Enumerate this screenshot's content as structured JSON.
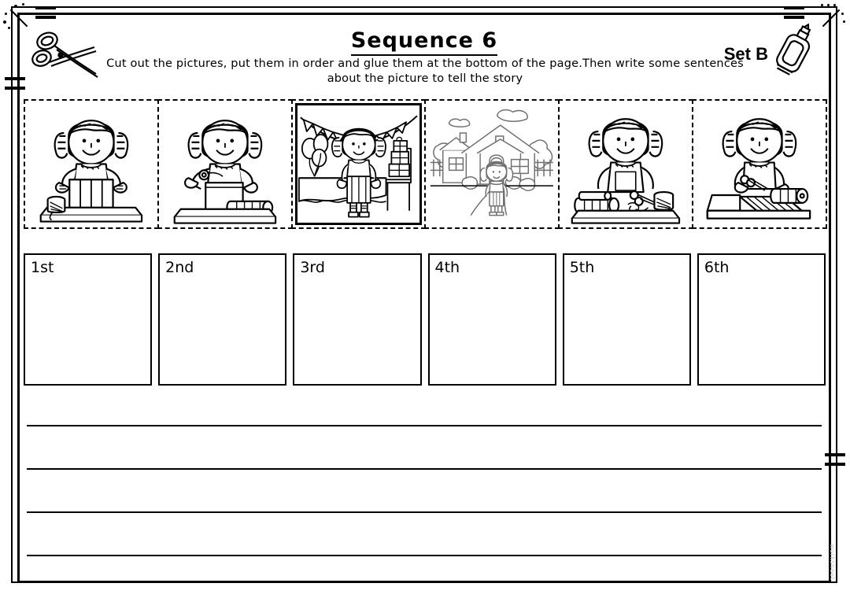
{
  "worksheet": {
    "title": "Sequence 6",
    "set_label": "Set B",
    "instructions": "Cut out the pictures, put them in order and glue them at the bottom of the page.Then write some sentences about the picture to tell the story",
    "watermark": "worksheet"
  },
  "decor": {
    "scissors_icon": "scissors-icon",
    "glue_icon": "glue-bottle-icon"
  },
  "cards": [
    {
      "id": "card-1",
      "name": "girl-holding-wrapped-gift",
      "description": "Girl with pigtails at a table holding a finished wrapped present with a ribbon spool beside her",
      "selected": false
    },
    {
      "id": "card-2",
      "name": "girl-placing-box-on-paper",
      "description": "Girl placing a plain box onto a sheet of wrapping paper with a paper roll on the table",
      "selected": false
    },
    {
      "id": "card-3",
      "name": "birthday-party-scene",
      "description": "Party scene with bunting, balloons, a covered table, stacked gifts on a chair and the girl standing in the middle",
      "selected": true
    },
    {
      "id": "card-4",
      "name": "girl-outside-house",
      "description": "Girl standing on a path in front of a house with trees, fence and clouds",
      "selected": false
    },
    {
      "id": "card-5",
      "name": "girl-with-paper-rolls",
      "description": "Girl at a table with rolls of wrapping paper, scissors and a spool of ribbon",
      "selected": false
    },
    {
      "id": "card-6",
      "name": "girl-cutting-paper",
      "description": "Girl cutting a sheet of wrapping paper with scissors next to a paper roll",
      "selected": false
    }
  ],
  "answer_boxes": [
    {
      "label": "1st",
      "value": ""
    },
    {
      "label": "2nd",
      "value": ""
    },
    {
      "label": "3rd",
      "value": ""
    },
    {
      "label": "4th",
      "value": ""
    },
    {
      "label": "5th",
      "value": ""
    },
    {
      "label": "6th",
      "value": ""
    }
  ],
  "writing_lines": [
    {
      "value": ""
    },
    {
      "value": ""
    },
    {
      "value": ""
    },
    {
      "value": ""
    }
  ],
  "colors": {
    "ink": "#000000",
    "paper": "#ffffff",
    "light_ink": "#707070"
  }
}
